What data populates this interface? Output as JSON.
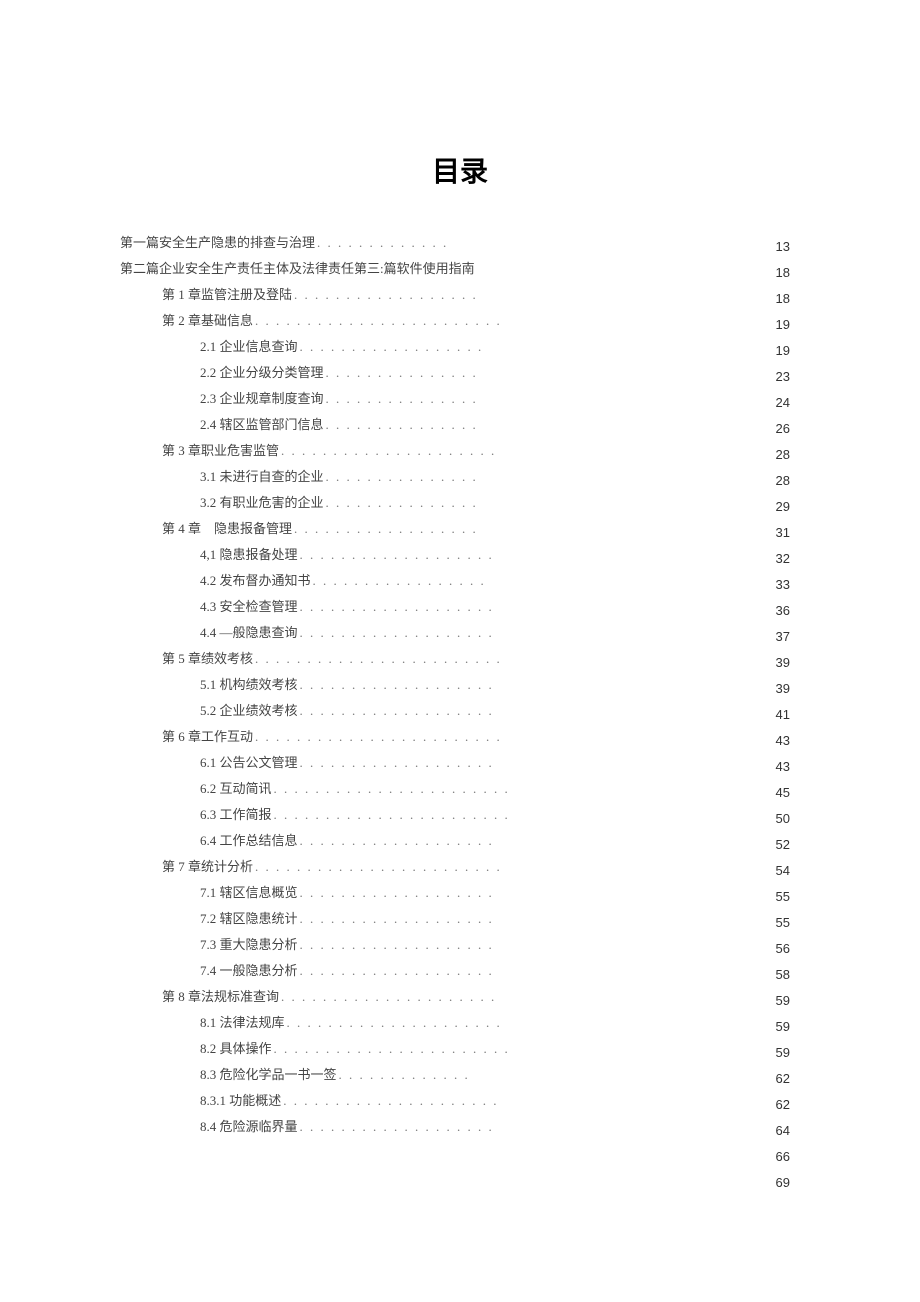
{
  "title": "目录",
  "entries": [
    {
      "indent": 0,
      "text": "第一篇安全生产隐患的排查与治理",
      "dots": ". . . . . . . . . . . . ."
    },
    {
      "indent": 0,
      "text": "第二篇企业安全生产责任主体及法律责任第三:篇软件使用指南",
      "dots": ""
    },
    {
      "indent": 1,
      "text": "第 1 章监管注册及登陆",
      "dots": ". . . . . . . . . . . . . . . . . ."
    },
    {
      "indent": 1,
      "text": "第 2 章基础信息",
      "dots": ". . . . . . . . . . . . . . . . . . . . . . . ."
    },
    {
      "indent": 2,
      "text": "2.1 企业信息查询",
      "dots": ". . . . . . . . . . . . . . . . . ."
    },
    {
      "indent": 2,
      "text": "2.2 企业分级分类管理",
      "dots": ". . . . . . . . . . . . . . ."
    },
    {
      "indent": 2,
      "text": "2.3 企业规章制度查询",
      "dots": ". . . . . . . . . . . . . . ."
    },
    {
      "indent": 2,
      "text": "2.4 辖区监管部门信息",
      "dots": ". . . . . . . . . . . . . . ."
    },
    {
      "indent": 1,
      "text": "第 3 章职业危害监管",
      "dots": ". . . . . . . . . . . . . . . . . . . . ."
    },
    {
      "indent": 2,
      "text": "3.1 未进行自查的企业",
      "dots": ". . . . . . . . . . . . . . ."
    },
    {
      "indent": 2,
      "text": "3.2 有职业危害的企业",
      "dots": ". . . . . . . . . . . . . . ."
    },
    {
      "indent": 1,
      "text": "第 4 章　隐患报备管理",
      "dots": ". . . . . . . . . . . . . . . . . ."
    },
    {
      "indent": 2,
      "text": "4,1 隐患报备处理",
      "dots": ". . . . . . . . . . . . . . . . . . ."
    },
    {
      "indent": 2,
      "text": "4.2 发布督办通知书",
      "dots": ". . . . . . . . . . . . . . . . ."
    },
    {
      "indent": 2,
      "text": "4.3 安全检查管理",
      "dots": ". . . . . . . . . . . . . . . . . . ."
    },
    {
      "indent": 2,
      "text": "4.4 —般隐患查询",
      "dots": ". . . . . . . . . . . . . . . . . . ."
    },
    {
      "indent": 1,
      "text": "第 5 章绩效考核",
      "dots": ". . . . . . . . . . . . . . . . . . . . . . . ."
    },
    {
      "indent": 2,
      "text": "5.1 机构绩效考核",
      "dots": ". . . . . . . . . . . . . . . . . . ."
    },
    {
      "indent": 2,
      "text": "5.2 企业绩效考核",
      "dots": ". . . . . . . . . . . . . . . . . . ."
    },
    {
      "indent": 1,
      "text": "第 6 章工作互动",
      "dots": ". . . . . . . . . . . . . . . . . . . . . . . ."
    },
    {
      "indent": 2,
      "text": "6.1 公告公文管理",
      "dots": ". . . . . . . . . . . . . . . . . . ."
    },
    {
      "indent": 2,
      "text": "6.2 互动简讯",
      "dots": ". . . . . . . . . . . . . . . . . . . . . . ."
    },
    {
      "indent": 2,
      "text": "6.3 工作简报",
      "dots": ". . . . . . . . . . . . . . . . . . . . . . ."
    },
    {
      "indent": 2,
      "text": "6.4 工作总结信息",
      "dots": ". . . . . . . . . . . . . . . . . . ."
    },
    {
      "indent": 1,
      "text": "第 7 章统计分析",
      "dots": ". . . . . . . . . . . . . . . . . . . . . . . ."
    },
    {
      "indent": 2,
      "text": "7.1 辖区信息概览",
      "dots": ". . . . . . . . . . . . . . . . . . ."
    },
    {
      "indent": 2,
      "text": "7.2 辖区隐患统计",
      "dots": ". . . . . . . . . . . . . . . . . . ."
    },
    {
      "indent": 2,
      "text": "7.3 重大隐患分析",
      "dots": ". . . . . . . . . . . . . . . . . . ."
    },
    {
      "indent": 2,
      "text": "7.4 一般隐患分析",
      "dots": ". . . . . . . . . . . . . . . . . . ."
    },
    {
      "indent": 1,
      "text": "第 8 章法规标准查询",
      "dots": ". . . . . . . . . . . . . . . . . . . . ."
    },
    {
      "indent": 2,
      "text": "8.1 法律法规库",
      "dots": ". . . . . . . . . . . . . . . . . . . . ."
    },
    {
      "indent": 2,
      "text": "8.2 具体操作",
      "dots": ". . . . . . . . . . . . . . . . . . . . . . ."
    },
    {
      "indent": 2,
      "text": "8.3 危险化学品一书一签",
      "dots": ". . . . . . . . . . . . ."
    },
    {
      "indent": 2,
      "text": "8.3.1 功能概述",
      "dots": ". . . . . . . . . . . . . . . . . . . . ."
    },
    {
      "indent": 2,
      "text": "8.4 危险源临界量",
      "dots": ". . . . . . . . . . . . . . . . . . ."
    }
  ],
  "pages": [
    "13",
    "18",
    "18",
    "19",
    "19",
    "23",
    "24",
    "26",
    "28",
    "28",
    "29",
    "31",
    "32",
    "33",
    "36",
    "37",
    "39",
    "39",
    "41",
    "43",
    "43",
    "45",
    "50",
    "52",
    "54",
    "55",
    "55",
    "56",
    "58",
    "59",
    "59",
    "59",
    "62",
    "62",
    "64",
    "66",
    "69"
  ]
}
